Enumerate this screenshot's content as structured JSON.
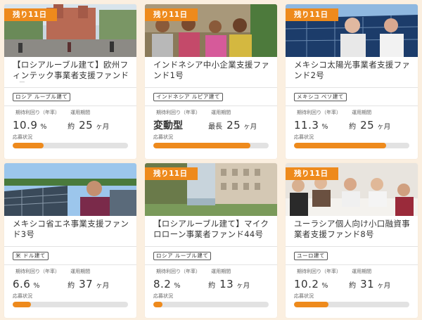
{
  "accent": "#ee8a1c",
  "labels": {
    "rate": "期待利回り（年率）",
    "period": "運用期間",
    "status": "応募状況",
    "months": "ヶ月",
    "percent": "%"
  },
  "cards": [
    {
      "ribbon": "残り11日",
      "title": "【ロシアルーブル建て】欧州フィンテック事業者支援ファンド1号",
      "currency_tag": "ロシア ルーブル建て",
      "rate_value": "10.9",
      "rate_unit": "%",
      "period_prefix": "約",
      "period_value": "25",
      "progress": 0.27
    },
    {
      "ribbon": "残り11日",
      "title": "インドネシア中小企業支援ファンド1号",
      "currency_tag": "インドネシア ルピア建て",
      "rate_value": "変動型",
      "rate_unit": "",
      "period_prefix": "最長",
      "period_value": "25",
      "progress": 0.84
    },
    {
      "ribbon": "残り11日",
      "title": "メキシコ太陽光事業者支援ファンド2号",
      "currency_tag": "メキシコ ペソ建て",
      "rate_value": "11.3",
      "rate_unit": "%",
      "period_prefix": "約",
      "period_value": "25",
      "progress": 0.8
    },
    {
      "ribbon": "残り11日",
      "title": "メキシコ省エネ事業支援ファンド3号",
      "currency_tag": "米 ドル建て",
      "rate_value": "6.6",
      "rate_unit": "%",
      "period_prefix": "約",
      "period_value": "37",
      "progress": 0.16
    },
    {
      "ribbon": "残り11日",
      "title": "【ロシアルーブル建て】マイクロローン事業者ファンド44号",
      "currency_tag": "ロシア ルーブル建て",
      "rate_value": "8.2",
      "rate_unit": "%",
      "period_prefix": "約",
      "period_value": "13",
      "progress": 0.08
    },
    {
      "ribbon": "残り11日",
      "title": "ユーラシア個人向け小口融資事業者支援ファンド8号",
      "currency_tag": "ユーロ建て",
      "rate_value": "10.2",
      "rate_unit": "%",
      "period_prefix": "約",
      "period_value": "31",
      "progress": 0.3
    }
  ]
}
